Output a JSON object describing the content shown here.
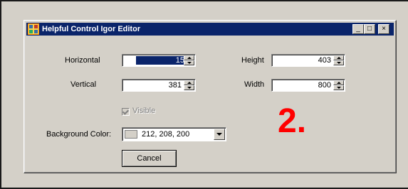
{
  "window": {
    "title": "Helpful Control Igor Editor"
  },
  "caption_buttons": {
    "minimize": "_",
    "maximize": "□",
    "close": "×"
  },
  "fields": {
    "horizontal": {
      "label": "Horizontal",
      "value": "15"
    },
    "vertical": {
      "label": "Vertical",
      "value": "381"
    },
    "height": {
      "label": "Height",
      "value": "403"
    },
    "width": {
      "label": "Width",
      "value": "800"
    }
  },
  "visible": {
    "label": "Visible",
    "checked": true,
    "enabled": false
  },
  "background_color": {
    "label": "Background Color:",
    "value": "212, 208, 200",
    "swatch": "#d4d0c8"
  },
  "buttons": {
    "cancel": "Cancel"
  },
  "annotation": "2.",
  "colors": {
    "titlebar": "#0a246a",
    "annotation": "#ff0000",
    "dialog_bg": "#d4d0c8"
  }
}
